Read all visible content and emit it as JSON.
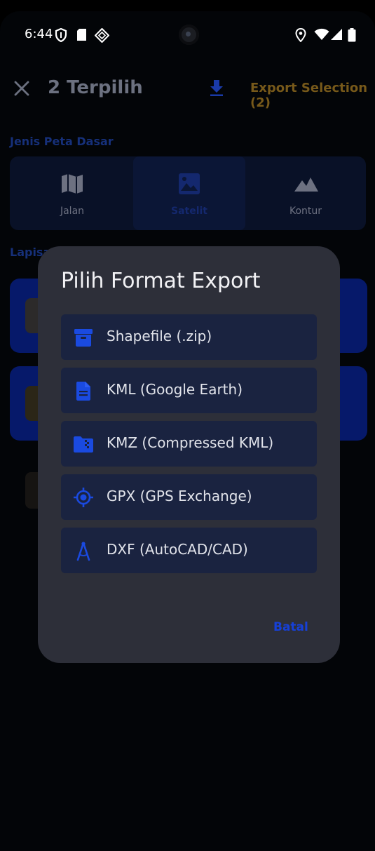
{
  "status_bar": {
    "time": "6:44"
  },
  "app_bar": {
    "title": "2 Terpilih",
    "export_selection": "Export Selection (2)"
  },
  "basemap": {
    "label": "Jenis Peta Dasar",
    "options": [
      {
        "label": "Jalan",
        "icon": "map-icon"
      },
      {
        "label": "Satelit",
        "icon": "satellite-image-icon",
        "selected": true
      },
      {
        "label": "Kontur",
        "icon": "terrain-icon"
      }
    ]
  },
  "layers": {
    "label": "Lapisan"
  },
  "dialog": {
    "title": "Pilih Format Export",
    "options": [
      {
        "label": "Shapefile (.zip)",
        "icon": "archive-icon"
      },
      {
        "label": "KML (Google Earth)",
        "icon": "document-icon"
      },
      {
        "label": "KMZ (Compressed KML)",
        "icon": "zip-folder-icon"
      },
      {
        "label": "GPX (GPS Exchange)",
        "icon": "gps-target-icon"
      },
      {
        "label": "DXF (AutoCAD/CAD)",
        "icon": "compass-drafting-icon"
      }
    ],
    "cancel": "Batal"
  },
  "colors": {
    "accent_blue": "#1640d8",
    "option_bg": "#1a2340",
    "dialog_bg": "#2d2f39",
    "export_gold": "#77591a"
  }
}
